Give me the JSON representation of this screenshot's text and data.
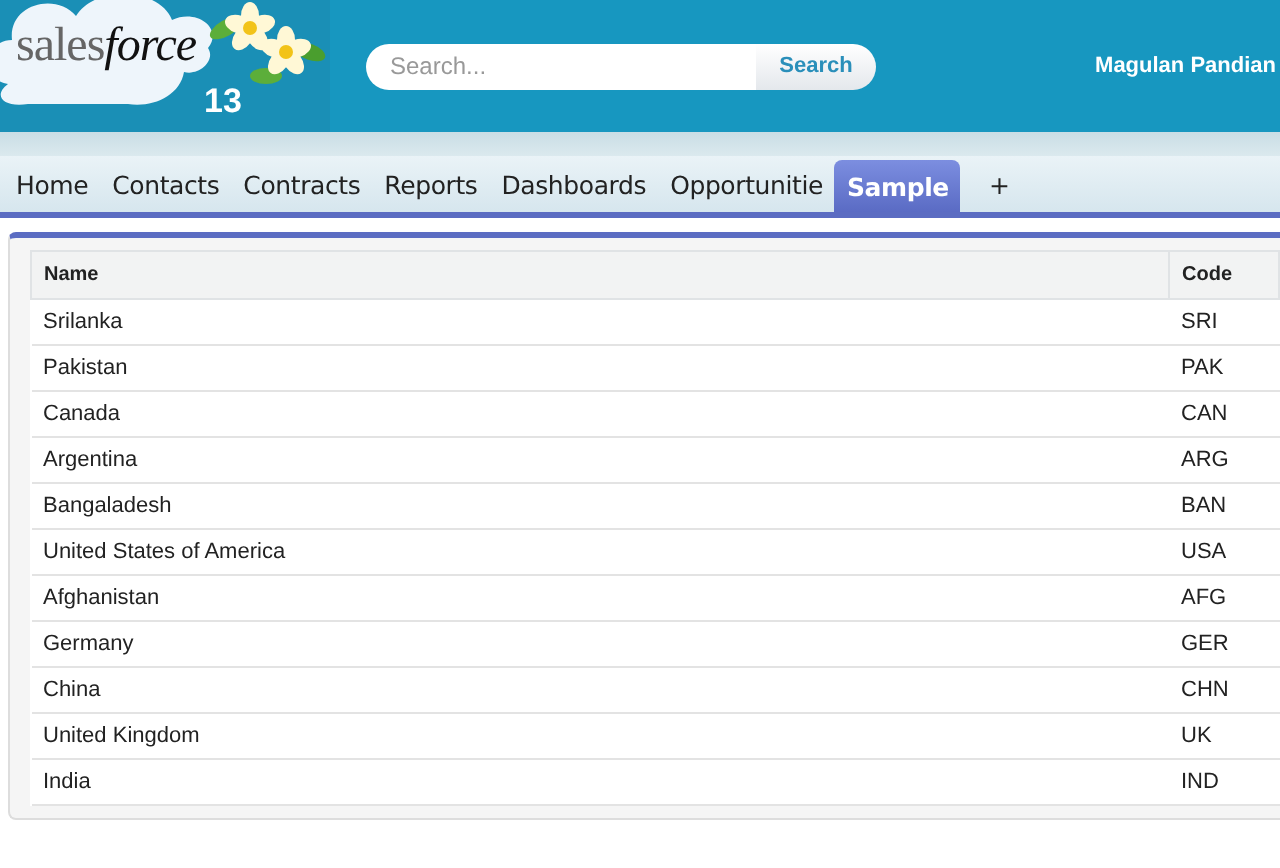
{
  "header": {
    "logo": {
      "wordmark_light": "sales",
      "wordmark_script": "force",
      "release": "13"
    },
    "search": {
      "placeholder": "Search...",
      "button": "Search"
    },
    "user": "Magulan Pandian"
  },
  "tabs": [
    {
      "label": "Home",
      "selected": false
    },
    {
      "label": "Contacts",
      "selected": false
    },
    {
      "label": "Contracts",
      "selected": false
    },
    {
      "label": "Reports",
      "selected": false
    },
    {
      "label": "Dashboards",
      "selected": false
    },
    {
      "label": "Opportunitie",
      "selected": false
    },
    {
      "label": "Sample",
      "selected": true
    },
    {
      "label": "+",
      "selected": false
    }
  ],
  "table": {
    "columns": [
      "Name",
      "Code"
    ],
    "rows": [
      [
        "Srilanka",
        "SRI"
      ],
      [
        "Pakistan",
        "PAK"
      ],
      [
        "Canada",
        "CAN"
      ],
      [
        "Argentina",
        "ARG"
      ],
      [
        "Bangaladesh",
        "BAN"
      ],
      [
        "United States of America",
        "USA"
      ],
      [
        "Afghanistan",
        "AFG"
      ],
      [
        "Germany",
        "GER"
      ],
      [
        "China",
        "CHN"
      ],
      [
        "United Kingdom",
        "UK"
      ],
      [
        "India",
        "IND"
      ]
    ]
  }
}
